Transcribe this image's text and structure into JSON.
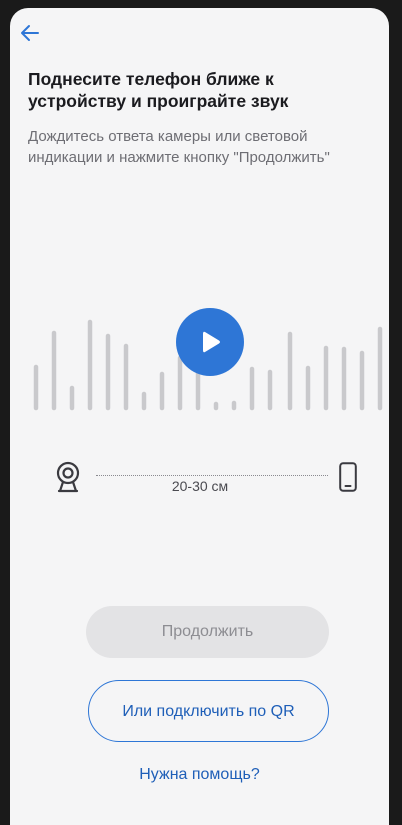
{
  "header": {
    "back_icon": "arrow-left-icon"
  },
  "content": {
    "title": "Поднесите телефон ближе к устройству и проиграйте звук",
    "subtitle": "Дождитесь ответа камеры или световой индикации и нажмите кнопку \"Продолжить\""
  },
  "player": {
    "play_icon": "play-icon"
  },
  "distance": {
    "label": "20-30 см",
    "left_icon": "camera-icon",
    "right_icon": "phone-icon"
  },
  "actions": {
    "continue_label": "Продолжить",
    "qr_label": "Или подключить по QR",
    "help_label": "Нужна помощь?"
  },
  "colors": {
    "accent": "#2e76d6",
    "link": "#1f5fb8",
    "wave_bar": "#c9c9cc",
    "disabled_bg": "#e3e3e5"
  }
}
